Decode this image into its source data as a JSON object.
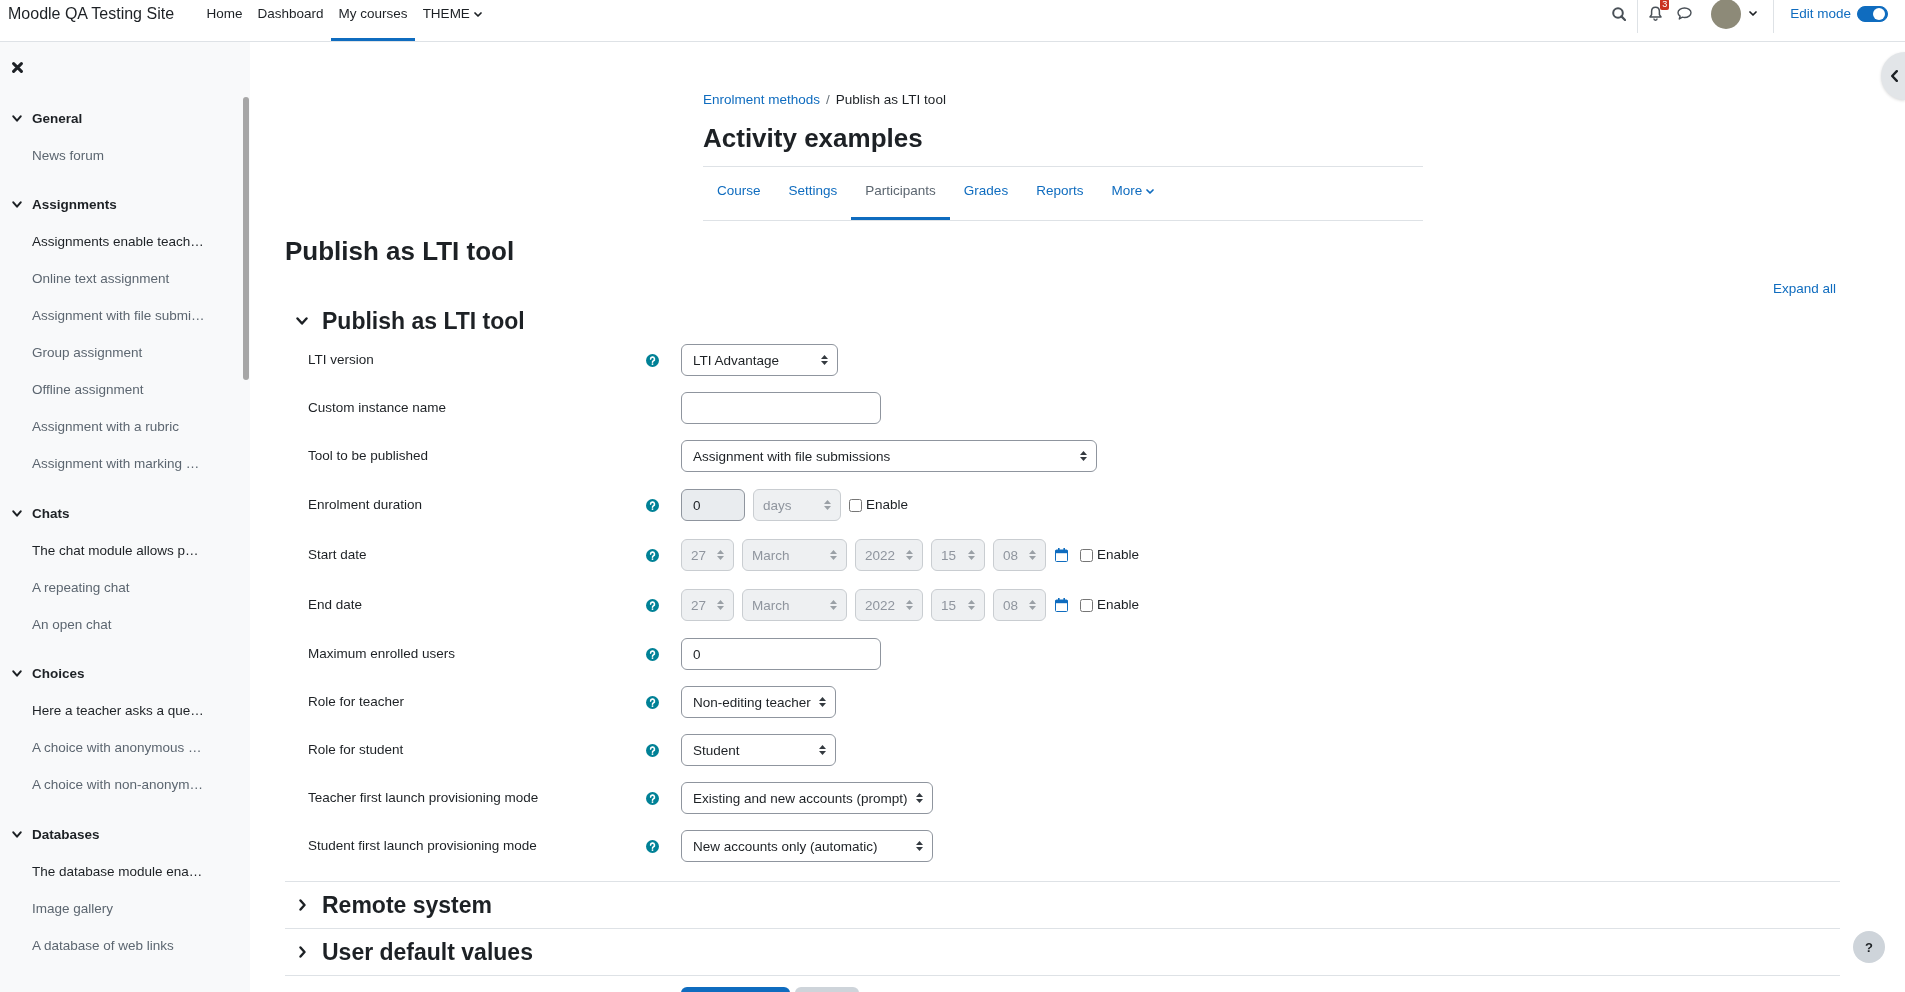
{
  "navbar": {
    "site_name": "Moodle QA Testing Site",
    "links": [
      {
        "label": "Home",
        "kind": "link",
        "selected": false
      },
      {
        "label": "Dashboard",
        "kind": "link",
        "selected": false
      },
      {
        "label": "My courses",
        "kind": "link",
        "selected": true
      },
      {
        "label": "THEME",
        "kind": "menu",
        "selected": false
      }
    ],
    "notification_count": "3",
    "edit_mode": {
      "label": "Edit mode",
      "on": true
    }
  },
  "course_index": {
    "sections": [
      {
        "title": "General",
        "expanded": true,
        "items": [
          {
            "label": "News forum",
            "kind": "activity"
          }
        ]
      },
      {
        "title": "Assignments",
        "expanded": true,
        "items": [
          {
            "label": "Assignments enable teach…",
            "kind": "label"
          },
          {
            "label": "Online text assignment",
            "kind": "activity"
          },
          {
            "label": "Assignment with file submi…",
            "kind": "activity"
          },
          {
            "label": "Group assignment",
            "kind": "activity"
          },
          {
            "label": "Offline assignment",
            "kind": "activity"
          },
          {
            "label": "Assignment with a rubric",
            "kind": "activity"
          },
          {
            "label": "Assignment with marking …",
            "kind": "activity"
          }
        ]
      },
      {
        "title": "Chats",
        "expanded": true,
        "items": [
          {
            "label": "The chat module allows p…",
            "kind": "label"
          },
          {
            "label": "A repeating chat",
            "kind": "activity"
          },
          {
            "label": "An open chat",
            "kind": "activity"
          }
        ]
      },
      {
        "title": "Choices",
        "expanded": true,
        "items": [
          {
            "label": "Here a teacher asks a que…",
            "kind": "label"
          },
          {
            "label": "A choice with anonymous …",
            "kind": "activity"
          },
          {
            "label": "A choice with non-anonym…",
            "kind": "activity"
          }
        ]
      },
      {
        "title": "Databases",
        "expanded": true,
        "items": [
          {
            "label": "The database module ena…",
            "kind": "label"
          },
          {
            "label": "Image gallery",
            "kind": "activity"
          },
          {
            "label": "A database of web links",
            "kind": "activity"
          }
        ]
      }
    ]
  },
  "header": {
    "breadcrumb": {
      "items": [
        {
          "label": "Enrolment methods",
          "kind": "link"
        },
        {
          "label": "Publish as LTI tool",
          "kind": "current"
        }
      ],
      "separator": "/"
    },
    "title": "Activity examples",
    "tabs": [
      {
        "label": "Course",
        "kind": "link",
        "selected": false
      },
      {
        "label": "Settings",
        "kind": "link",
        "selected": false
      },
      {
        "label": "Participants",
        "kind": "link",
        "selected": true
      },
      {
        "label": "Grades",
        "kind": "link",
        "selected": false
      },
      {
        "label": "Reports",
        "kind": "link",
        "selected": false
      },
      {
        "label": "More",
        "kind": "menu",
        "selected": false
      }
    ]
  },
  "page_title": "Publish as LTI tool",
  "expand_all": "Expand all",
  "sections": [
    {
      "title": "Publish as LTI tool",
      "expanded": true,
      "fields": [
        {
          "label": "LTI version",
          "help": true,
          "kind": "select",
          "value": "LTI Advantage"
        },
        {
          "label": "Custom instance name",
          "help": false,
          "kind": "text"
        },
        {
          "label": "Tool to be published",
          "help": false,
          "kind": "select",
          "value": "Assignment with file submissions"
        },
        {
          "label": "Enrolment duration",
          "help": true,
          "kind": "duration",
          "value": "0",
          "unit": "days",
          "disabled": true,
          "enable": {
            "label": "Enable",
            "checked": false
          }
        },
        {
          "label": "Start date",
          "help": true,
          "kind": "date",
          "parts": [
            "27",
            "March",
            "2022",
            "15",
            "08"
          ],
          "disabled": true,
          "enable": {
            "label": "Enable",
            "checked": false
          }
        },
        {
          "label": "End date",
          "help": true,
          "kind": "date",
          "parts": [
            "27",
            "March",
            "2022",
            "15",
            "08"
          ],
          "disabled": true,
          "enable": {
            "label": "Enable",
            "checked": false
          }
        },
        {
          "label": "Maximum enrolled users",
          "help": true,
          "kind": "text",
          "value": "0"
        },
        {
          "label": "Role for teacher",
          "help": true,
          "kind": "select",
          "value": "Non-editing teacher"
        },
        {
          "label": "Role for student",
          "help": true,
          "kind": "select",
          "value": "Student"
        },
        {
          "label": "Teacher first launch provisioning mode",
          "help": true,
          "kind": "select",
          "value": "Existing and new accounts (prompt)"
        },
        {
          "label": "Student first launch provisioning mode",
          "help": true,
          "kind": "select",
          "value": "New accounts only (automatic)"
        }
      ]
    },
    {
      "title": "Remote system",
      "expanded": false
    },
    {
      "title": "User default values",
      "expanded": false
    }
  ],
  "help_button": "?"
}
